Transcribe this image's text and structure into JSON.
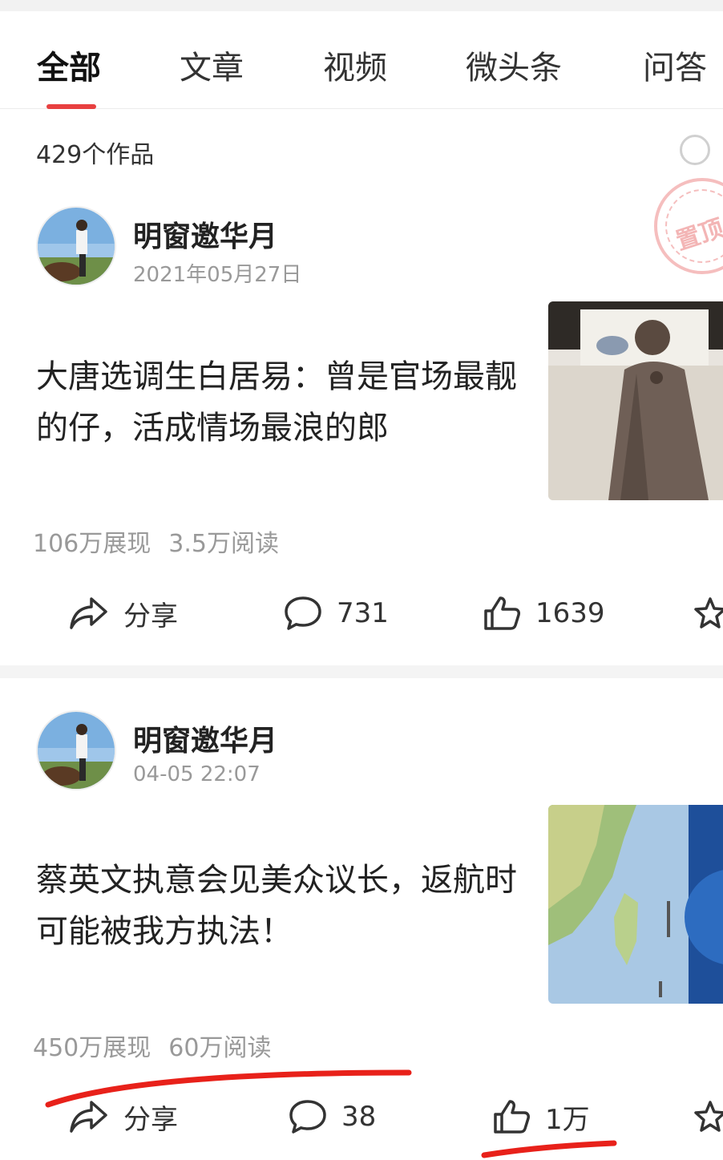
{
  "tabs": [
    {
      "label": "全部",
      "active": true
    },
    {
      "label": "文章",
      "active": false
    },
    {
      "label": "视频",
      "active": false
    },
    {
      "label": "微头条",
      "active": false
    },
    {
      "label": "问答",
      "active": false
    }
  ],
  "works_count": "429个作品",
  "stamp_text": "置顶",
  "posts": [
    {
      "author": "明窗邀华月",
      "date": "2021年05月27日",
      "title": "大唐选调生白居易：曾是官场最靓的仔，活成情场最浪的郎",
      "impressions": "106万展现",
      "reads": "3.5万阅读",
      "share_label": "分享",
      "comments": "731",
      "likes": "1639"
    },
    {
      "author": "明窗邀华月",
      "date": "04-05 22:07",
      "title": "蔡英文执意会见美众议长，返航时可能被我方执法！",
      "impressions": "450万展现",
      "reads": "60万阅读",
      "share_label": "分享",
      "comments": "38",
      "likes": "1万"
    }
  ],
  "icons": {
    "share": "share-arrow-icon",
    "comment": "speech-bubble-icon",
    "like": "thumbs-up-icon",
    "favorite": "star-icon"
  },
  "colors": {
    "accent": "#e84040",
    "annotation": "#e8211a"
  }
}
